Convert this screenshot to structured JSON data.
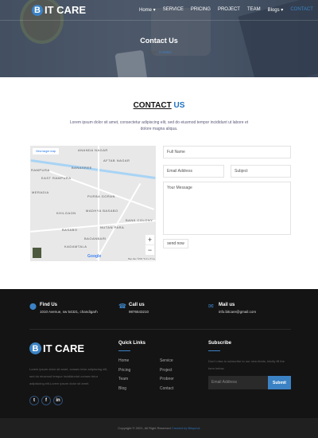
{
  "brand": {
    "name": "IT CARE",
    "mark": "B"
  },
  "nav": [
    "Home ▾",
    "SERVICE",
    "PRICING",
    "PROJECT",
    "TEAM",
    "Blogs ▾",
    "CONTACT"
  ],
  "hero": {
    "title": "Contact Us",
    "breadcrumb_home": "Home",
    "breadcrumb_sep": "/",
    "breadcrumb_current": "Contact"
  },
  "section": {
    "title_a": "CONTACT",
    "title_b": "US",
    "description": "Lorem ipsum dolor sit amet, consectetur adipiscing elit, sed do eiusmod tempor incididunt ut labore et dolore magna aliqua."
  },
  "map": {
    "larger": "View larger map",
    "labels": [
      "ANANDA NAGAR",
      "AFTAB NAGAR",
      "BANASREE",
      "RAMPURA",
      "EAST RAMPURA",
      "MERADIA",
      "PURBA GORAN",
      "KHILGAON",
      "MADHYA BASABO",
      "BANK COLONY",
      "BASABO",
      "NUTAN PARA",
      "BAGANBARI",
      "KADAMTALA"
    ],
    "zoom_in": "+",
    "zoom_out": "−",
    "google": "Google",
    "attribution": "Map data ©2021  Terms of Use"
  },
  "form": {
    "full_name": "Full Name",
    "email": "Email Address",
    "subject": "Subject",
    "message": "Your Message",
    "send": "send now"
  },
  "footer": {
    "find": {
      "title": "Find Us",
      "value": "1010 Avenue, sw 54321, chandigarh"
    },
    "call": {
      "title": "Call us",
      "value": "9876543210"
    },
    "mail": {
      "title": "Mail us",
      "value": "info.bitcare@gmail.com"
    },
    "about": "Lorem ipsum dolor sit amet, consec tetur adipiscing elit, sed do eiusmod tempor incididuntut consec tetur adipisicing elit,Lorem ipsum dolor sit amet.",
    "social": [
      "t",
      "f",
      "in"
    ],
    "quick_title": "Quick Links",
    "links": [
      "Home",
      "Service",
      "Pricing",
      "Project",
      "Team",
      "Probner",
      "Blog",
      "Contact"
    ],
    "subscribe_title": "Subscribe",
    "subscribe_text": "Don't miss to subscribe to our new feeds, kindly fill the form below.",
    "subscribe_placeholder": "Email Address",
    "subscribe_button": "Submit",
    "copyright": "Copyright © 2021, All Right Reserved",
    "credit": "Created by Bitspeck"
  }
}
